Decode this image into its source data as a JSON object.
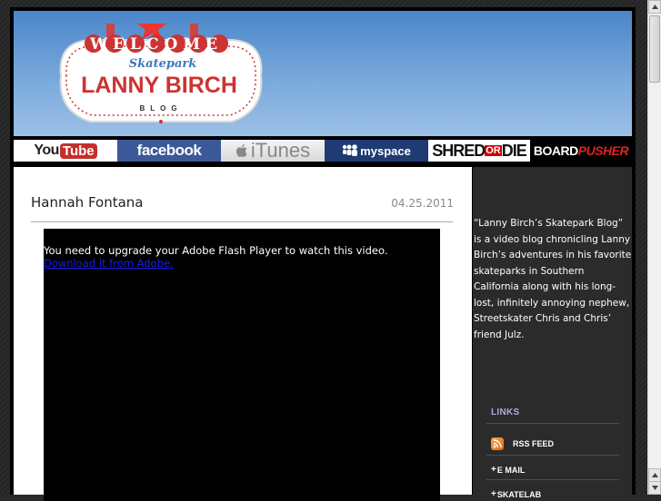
{
  "header": {
    "sign_welcome": "WELCOME",
    "sign_skatepark": "Skatepark",
    "sign_name": "LANNY BIRCH",
    "sign_blog": "BLOG"
  },
  "nav": {
    "youtube_you": "You",
    "youtube_tube": "Tube",
    "facebook": "facebook",
    "itunes": "iTunes",
    "myspace": "myspace",
    "shred": "SHRED",
    "or": "OR",
    "die": "DIE",
    "board": "BOARD",
    "pusher": "PUSHER"
  },
  "post": {
    "title": "Hannah Fontana",
    "date": "04.25.2011",
    "flash_message": "You need to upgrade your Adobe Flash Player to watch this video.",
    "flash_link": "Download it from Adobe."
  },
  "sidebar": {
    "about": "“Lanny Birch’s Skatepark Blog” is a video blog chronicling Lanny Birch’s adventures in his favorite skateparks in Southern California along with his long-lost, infinitely annoying nephew, Streetskater Chris and Chris’ friend Julz.",
    "links_title": "LINKS",
    "links": [
      {
        "label": "RSS FEED"
      },
      {
        "label": "E MAIL"
      },
      {
        "label": "SKATELAB"
      }
    ]
  },
  "colors": {
    "sky": "#79a9dc",
    "sidebar_bg": "#2b2b2b",
    "links_title": "#b7a8d8",
    "facebook": "#3b5998",
    "youtube_red": "#c4302b"
  }
}
